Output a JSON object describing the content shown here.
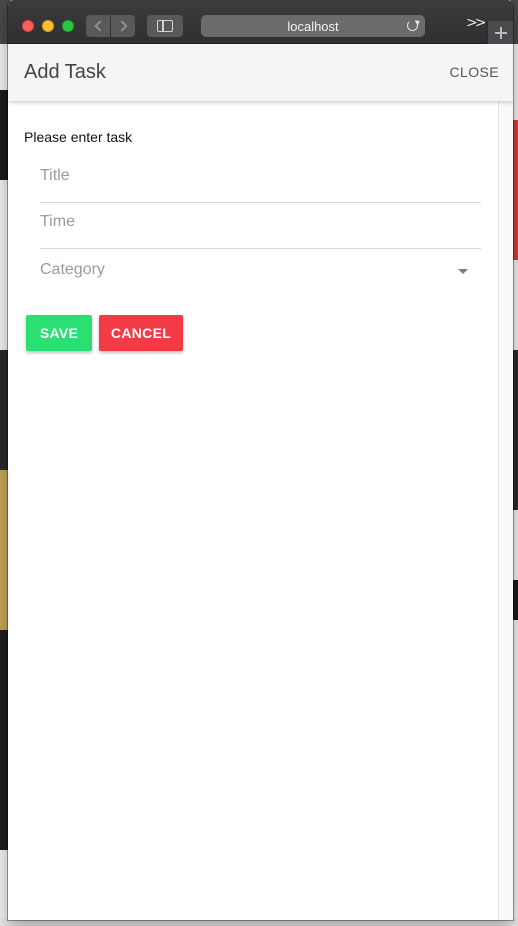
{
  "browser": {
    "address": "localhost"
  },
  "dialog": {
    "title": "Add Task",
    "close_label": "CLOSE",
    "prompt": "Please enter task",
    "fields": {
      "title_placeholder": "Title",
      "time_placeholder": "Time",
      "category_placeholder": "Category"
    },
    "buttons": {
      "save_label": "SAVE",
      "cancel_label": "CANCEL"
    }
  },
  "colors": {
    "save": "#2bdf73",
    "cancel": "#f23b45",
    "toolbar": "#f5f5f5",
    "chrome": "#38383a"
  },
  "icons": {
    "nav_back": "chevron-left-icon",
    "nav_forward": "chevron-right-icon",
    "sidebar": "sidebar-icon",
    "reload": "reload-icon",
    "overflow": "double-chevron-right-icon",
    "new_tab": "plus-icon",
    "select": "caret-down-icon"
  }
}
